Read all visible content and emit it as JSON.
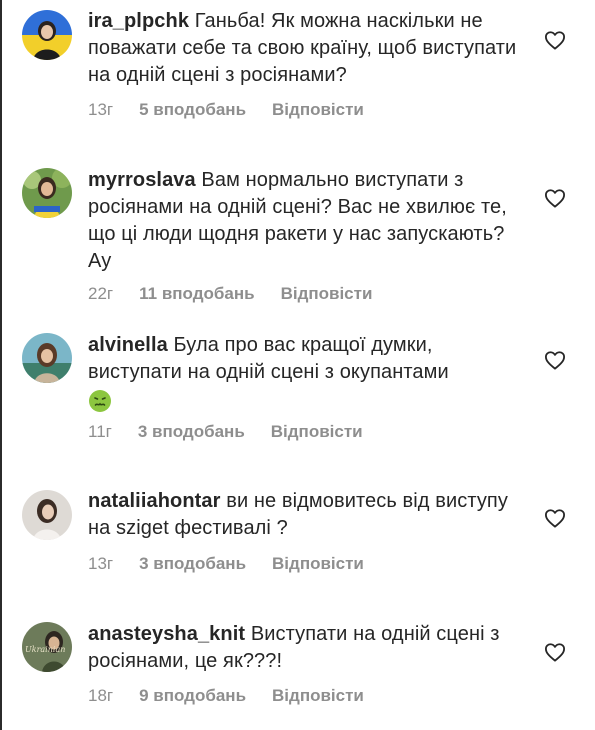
{
  "comments": [
    {
      "username": "ira_plpchk",
      "text": "Ганьба! Як можна наскільки не поважати себе та свою країну, щоб виступати на одній сцені з росіянами?",
      "time": "13г",
      "likes": "5 вподобань",
      "reply": "Відповісти"
    },
    {
      "username": "myrroslava",
      "text": "Вам нормально виступати з росіянами на одній сцені? Вас не хвилює те, що ці люди щодня ракети у нас запускають? Ау",
      "time": "22г",
      "likes": "11 вподобань",
      "reply": "Відповісти"
    },
    {
      "username": "alvinella",
      "text": "Була про вас кращої думки, виступати на одній сцені з окупантами",
      "emoji": "nauseated-face-icon",
      "time": "11г",
      "likes": "3 вподобань",
      "reply": "Відповісти"
    },
    {
      "username": "nataliiahontar",
      "text": "ви не відмовитесь від виступу на sziget фестивалі ?",
      "time": "13г",
      "likes": "3 вподобань",
      "reply": "Відповісти"
    },
    {
      "username": "anasteysha_knit",
      "text": "Виступати на одній сцені з росіянами, це як???!",
      "avatar_text": "Ukrainian",
      "time": "18г",
      "likes": "9 вподобань",
      "reply": "Відповісти"
    }
  ],
  "colors": {
    "text": "#262626",
    "secondary": "#8e8e8e",
    "background": "#ffffff"
  }
}
